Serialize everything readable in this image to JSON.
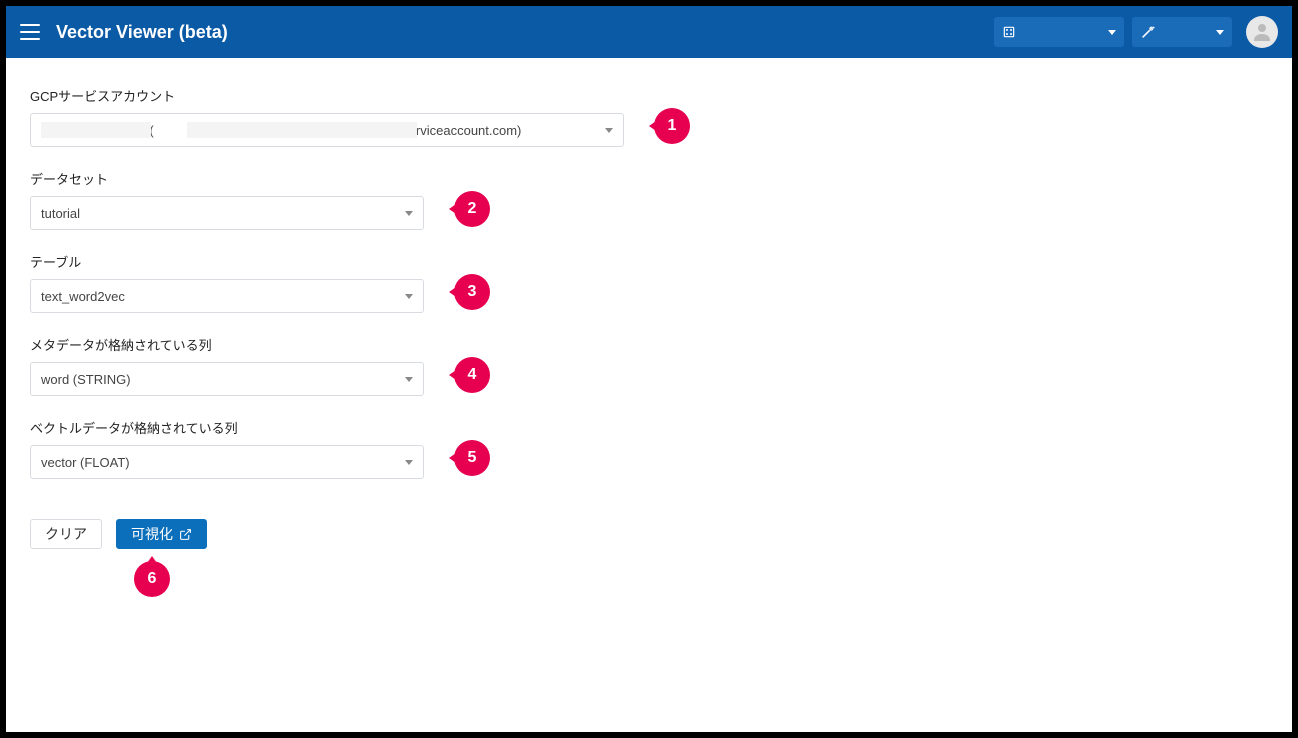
{
  "header": {
    "title": "Vector Viewer (beta)"
  },
  "form": {
    "account_label": "GCPサービスアカウント",
    "account_value": "                              (                                                           .iam.gserviceaccount.com)",
    "dataset_label": "データセット",
    "dataset_value": "tutorial",
    "table_label": "テーブル",
    "table_value": "text_word2vec",
    "meta_label": "メタデータが格納されている列",
    "meta_value": "word (STRING)",
    "vector_label": "ベクトルデータが格納されている列",
    "vector_value": "vector (FLOAT)"
  },
  "buttons": {
    "clear": "クリア",
    "visualize": "可視化"
  },
  "badges": {
    "b1": "1",
    "b2": "2",
    "b3": "3",
    "b4": "4",
    "b5": "5",
    "b6": "6"
  }
}
